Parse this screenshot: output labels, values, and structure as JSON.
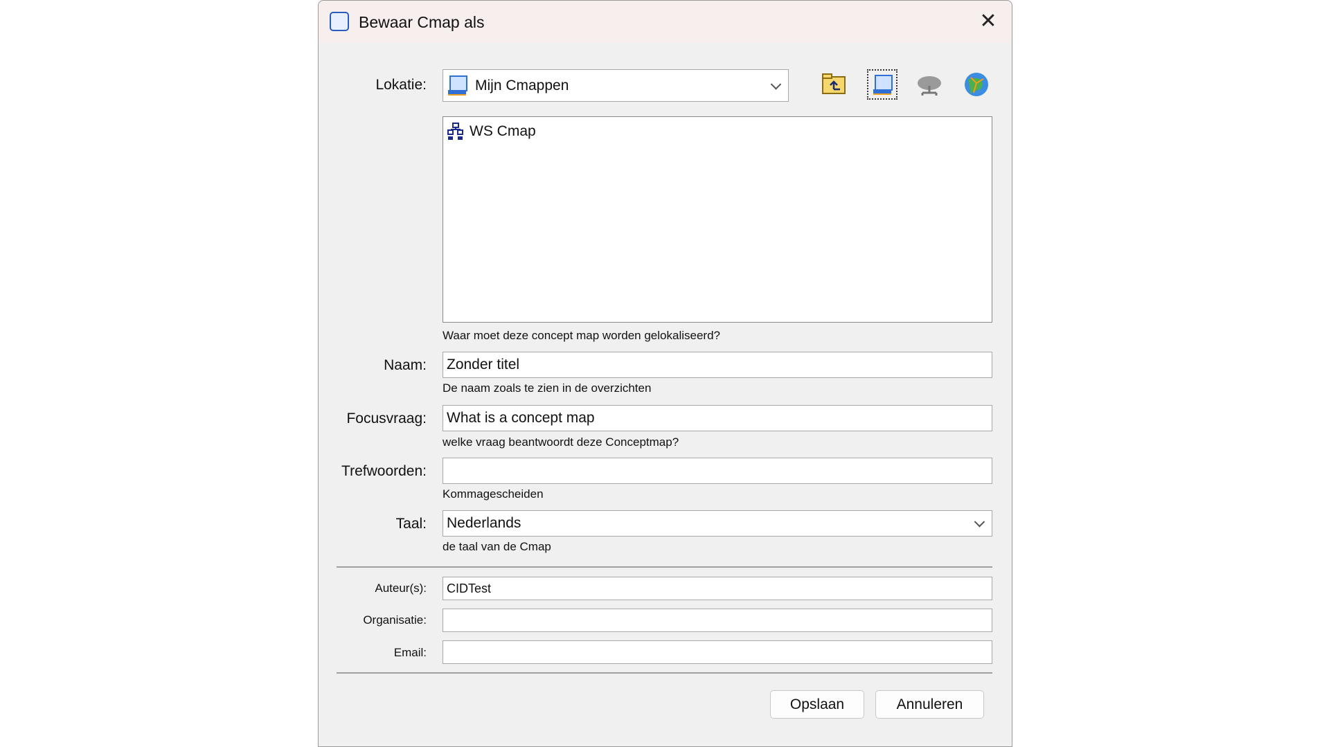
{
  "dialog": {
    "title": "Bewaar Cmap als"
  },
  "location": {
    "label": "Lokatie:",
    "value": "Mijn Cmappen",
    "hint": "Waar moet deze concept map worden gelokaliseerd?",
    "toolbar": [
      "folder-up-icon",
      "my-cmaps-computer-icon",
      "cmap-server-cloud-icon",
      "cmap-places-globe-icon"
    ],
    "items": [
      {
        "name": "WS Cmap"
      }
    ]
  },
  "name": {
    "label": "Naam:",
    "value": "Zonder titel",
    "hint": "De naam zoals te zien in de overzichten"
  },
  "focus": {
    "label": "Focusvraag:",
    "value": "What is a concept map",
    "hint": "welke vraag beantwoordt deze Conceptmap?"
  },
  "keywords": {
    "label": "Trefwoorden:",
    "value": "",
    "hint": "Kommagescheiden"
  },
  "language": {
    "label": "Taal:",
    "value": "Nederlands",
    "hint": "de taal van de Cmap"
  },
  "author": {
    "label": "Auteur(s):",
    "value": "CIDTest"
  },
  "organisation": {
    "label": "Organisatie:",
    "value": ""
  },
  "email": {
    "label": "Email:",
    "value": ""
  },
  "buttons": {
    "save": "Opslaan",
    "cancel": "Annuleren"
  }
}
